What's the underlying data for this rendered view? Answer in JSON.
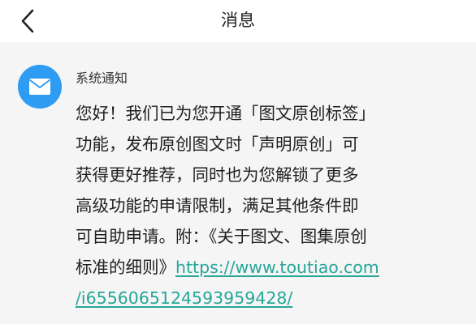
{
  "header": {
    "title": "消息",
    "back_icon": "chevron-left-icon"
  },
  "message": {
    "sender": "系统通知",
    "avatar_icon": "envelope-icon",
    "avatar_color": "#2e9cf3",
    "lines": [
      "您好！我们已为您开通「图文原创标签」",
      "功能，发布原创图文时「声明原创」可",
      "获得更好推荐，同时也为您解锁了更多",
      "高级功能的申请限制，满足其他条件即",
      "可自助申请。附：《关于图文、图集原创",
      "标准的细则》"
    ],
    "link_part1": "https://www.toutiao.com",
    "link_part2": "/i6556065124593959428/",
    "link_color": "#26a699"
  }
}
